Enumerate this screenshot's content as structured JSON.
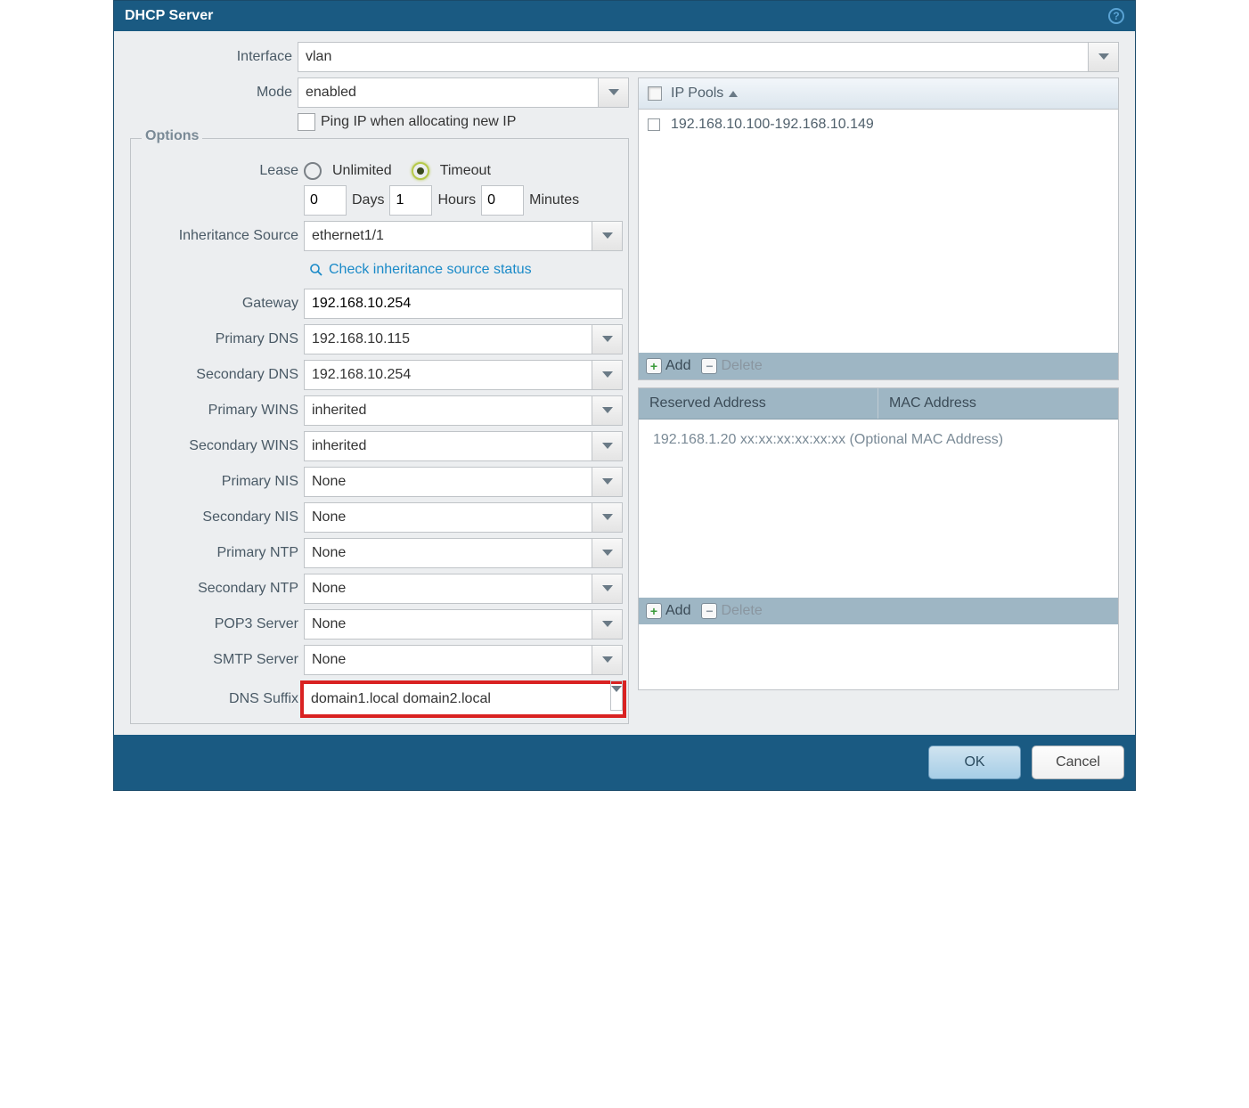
{
  "window_title": "DHCP Server",
  "labels": {
    "interface": "Interface",
    "mode": "Mode",
    "ping_ip": "Ping IP when allocating new IP",
    "options": "Options",
    "lease": "Lease",
    "unlimited": "Unlimited",
    "timeout": "Timeout",
    "days": "Days",
    "hours": "Hours",
    "minutes": "Minutes",
    "inheritance_source": "Inheritance Source",
    "check_inheritance": "Check inheritance source status",
    "gateway": "Gateway",
    "primary_dns": "Primary DNS",
    "secondary_dns": "Secondary DNS",
    "primary_wins": "Primary WINS",
    "secondary_wins": "Secondary WINS",
    "primary_nis": "Primary NIS",
    "secondary_nis": "Secondary NIS",
    "primary_ntp": "Primary NTP",
    "secondary_ntp": "Secondary NTP",
    "pop3": "POP3 Server",
    "smtp": "SMTP Server",
    "dns_suffix": "DNS Suffix",
    "ip_pools": "IP Pools",
    "reserved_address": "Reserved Address",
    "mac_address": "MAC Address",
    "add": "Add",
    "delete": "Delete",
    "ok": "OK",
    "cancel": "Cancel"
  },
  "values": {
    "interface": "vlan",
    "mode": "enabled",
    "days": "0",
    "hours": "1",
    "minutes": "0",
    "inheritance_source": "ethernet1/1",
    "gateway": "192.168.10.254",
    "primary_dns": "192.168.10.115",
    "secondary_dns": "192.168.10.254",
    "primary_wins": "inherited",
    "secondary_wins": "inherited",
    "primary_nis": "None",
    "secondary_nis": "None",
    "primary_ntp": "None",
    "secondary_ntp": "None",
    "pop3": "None",
    "smtp": "None",
    "dns_suffix": "domain1.local domain2.local"
  },
  "ip_pools": [
    "192.168.10.100-192.168.10.149"
  ],
  "reserved_placeholder": "192.168.1.20 xx:xx:xx:xx:xx:xx (Optional MAC Address)"
}
